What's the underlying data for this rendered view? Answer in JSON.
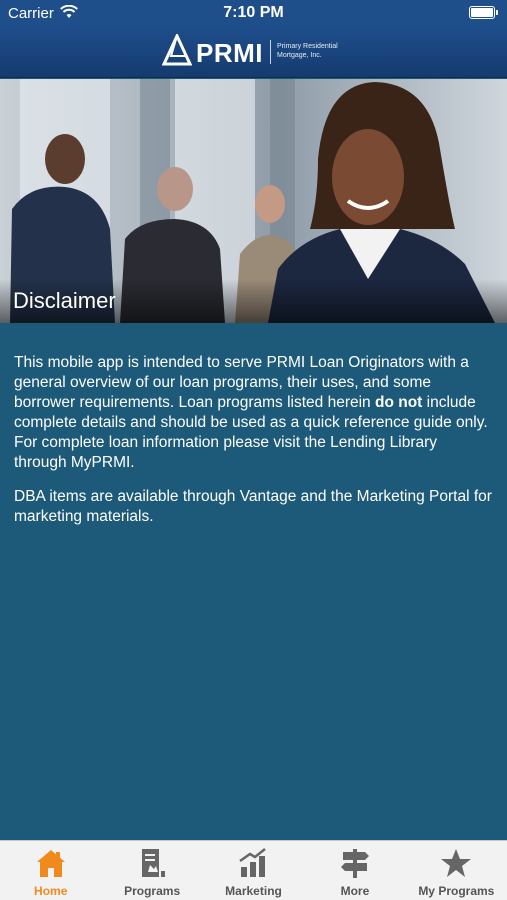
{
  "status_bar": {
    "carrier": "Carrier",
    "time": "7:10 PM"
  },
  "header": {
    "brand": "PRMI",
    "subtitle_line1": "Primary Residential",
    "subtitle_line2": "Mortgage, Inc."
  },
  "hero": {
    "title": "Disclaimer"
  },
  "content": {
    "p1_part1": "This mobile app is intended to serve PRMI Loan Originators with a general overview of our loan programs, their uses, and some borrower requirements. Loan programs listed herein ",
    "p1_bold": "do not",
    "p1_part2": " include complete details and should be used as a quick reference guide only. For complete loan information please visit the Lending Library through MyPRMI.",
    "p2": "DBA items are available through Vantage and the Marketing Portal for marketing materials."
  },
  "tabs": [
    {
      "label": "Home",
      "icon": "home-icon",
      "active": true
    },
    {
      "label": "Programs",
      "icon": "programs-icon",
      "active": false
    },
    {
      "label": "Marketing",
      "icon": "marketing-chart-icon",
      "active": false
    },
    {
      "label": "More",
      "icon": "signpost-icon",
      "active": false
    },
    {
      "label": "My Programs",
      "icon": "star-icon",
      "active": false
    }
  ],
  "colors": {
    "header": "#1e4e8c",
    "content_bg": "#1d5a7a",
    "tab_active": "#f08a1c",
    "tab_inactive": "#555555"
  }
}
